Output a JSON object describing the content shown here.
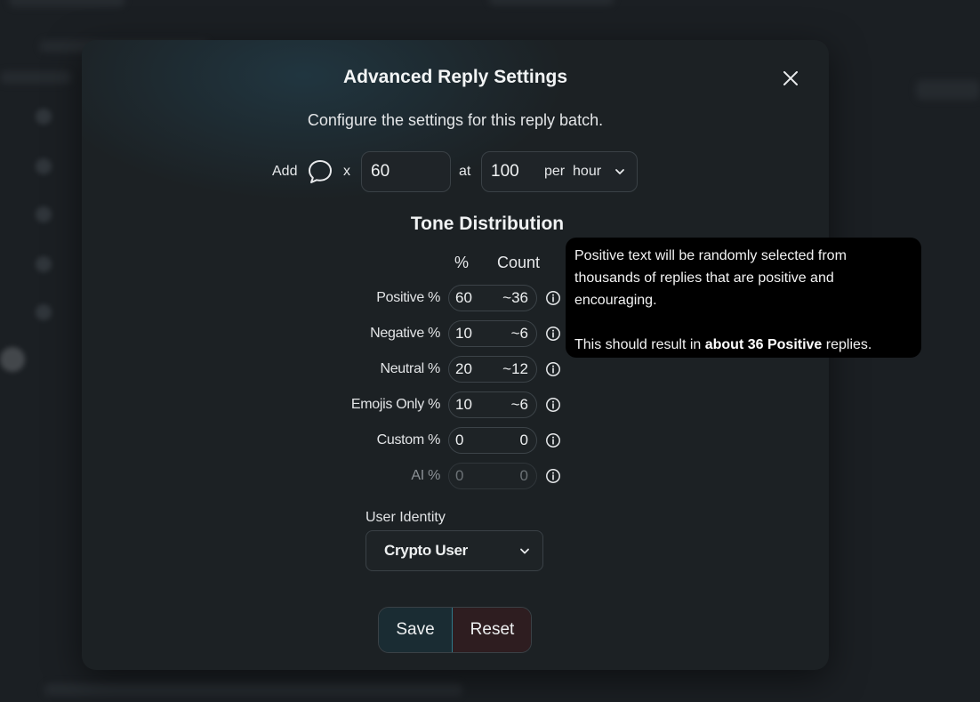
{
  "modal": {
    "title": "Advanced Reply Settings",
    "subtitle": "Configure the settings for this reply batch."
  },
  "batch": {
    "add_label": "Add",
    "multiply_label": "x",
    "count_value": "60",
    "at_label": "at",
    "rate_value": "100",
    "rate_unit": "per  hour"
  },
  "tone": {
    "title": "Tone Distribution",
    "col_percent": "%",
    "col_count": "Count",
    "rows": [
      {
        "label": "Positive %",
        "percent": "60",
        "count": "~36",
        "disabled": false
      },
      {
        "label": "Negative %",
        "percent": "10",
        "count": "~6",
        "disabled": false
      },
      {
        "label": "Neutral %",
        "percent": "20",
        "count": "~12",
        "disabled": false
      },
      {
        "label": "Emojis Only %",
        "percent": "10",
        "count": "~6",
        "disabled": false
      },
      {
        "label": "Custom %",
        "percent": "0",
        "count": "0",
        "disabled": false
      },
      {
        "label": "AI %",
        "percent": "0",
        "count": "0",
        "disabled": true
      }
    ]
  },
  "identity": {
    "label": "User Identity",
    "selected": "Crypto User"
  },
  "actions": {
    "save_label": "Save",
    "reset_label": "Reset"
  },
  "tooltip": {
    "line1": "Positive text will be randomly selected from thousands of replies that are positive and encouraging.",
    "line2_prefix": "This should result in ",
    "line2_bold": "about 36 Positive",
    "line2_suffix": " replies."
  },
  "icons": {
    "close": "close-icon",
    "bubble": "speech-bubble-icon",
    "chevron": "chevron-down-icon",
    "info": "info-icon"
  },
  "colors": {
    "save_bg": "#1a2c33",
    "reset_bg": "#2e1d20",
    "accent_divider": "#2f7a8a"
  }
}
